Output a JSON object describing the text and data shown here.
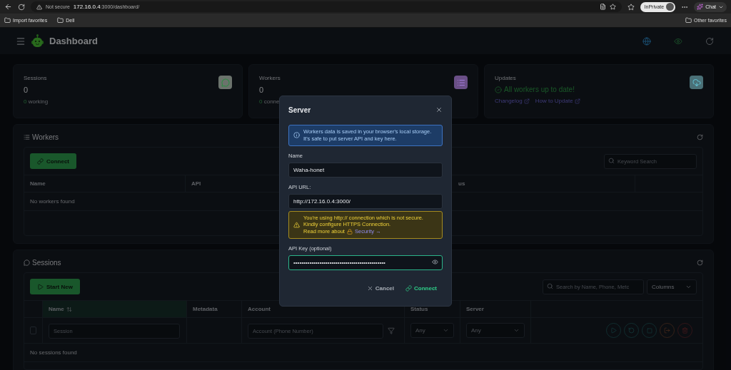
{
  "browser": {
    "security": "Not secure",
    "host": "172.16.0.4",
    "path": ":3000/dashboard/",
    "profile": "InPrivate",
    "chat": "Chat",
    "bookmarks": [
      "Import favorites",
      "Dell"
    ],
    "other_favorites": "Other favorites"
  },
  "header": {
    "title": "Dashboard"
  },
  "stats": [
    {
      "kind": "count",
      "label": "Sessions",
      "value": "0",
      "sub_count": "0",
      "sub_text": "working",
      "color": "#6b736c"
    },
    {
      "kind": "count",
      "label": "Workers",
      "value": "0",
      "sub_count": "0",
      "sub_text": "conne",
      "color": "#6a4f87"
    },
    {
      "kind": "updates",
      "label": "Updates",
      "status": "All workers up to date!",
      "links": [
        "Changelog",
        "How to Update"
      ],
      "color": "#4a7077"
    }
  ],
  "workers": {
    "title": "Workers",
    "connect_button": "Connect",
    "search_placeholder": "Keyword Search",
    "columns": [
      "Name",
      "API",
      "us"
    ],
    "empty": "No workers found"
  },
  "sessions": {
    "title": "Sessions",
    "start_button": "Start New",
    "search_placeholder": "Search by Name, Phone, Metc",
    "columns_select": "Columns",
    "columns": [
      {
        "label": "Name",
        "sorted": true
      },
      {
        "label": "Metadata",
        "sorted": false
      },
      {
        "label": "Account",
        "sorted": false
      },
      {
        "label": "Status",
        "sorted": false
      },
      {
        "label": "Server",
        "sorted": false
      }
    ],
    "select_all_checked": false,
    "session_placeholder": "Session",
    "account_placeholder": "Account (Phone Number)",
    "status_filter": "Any",
    "server_filter": "Any",
    "empty": "No sessions found"
  },
  "modal": {
    "title": "Server",
    "info": "Workers data is saved in your browser's local storage. It's safe to put server API and key here.",
    "fields": [
      {
        "label": "Name",
        "value": "Waha-honet",
        "focused": false
      },
      {
        "label": "API URL:",
        "value": "http://172.16.0.4:3000/",
        "focused": false
      },
      {
        "label": "API Key (optional)",
        "value": "••••••••••••••••••••••••••••••••••••••••••••••",
        "focused": true
      }
    ],
    "warning": {
      "text": "You're using http:// connection which is not secure. Kindly configure HTTPS Connection.",
      "link_prefix": "Read more about",
      "link": "Security →"
    },
    "cancel_button": "Cancel",
    "connect_button": "Connect"
  }
}
